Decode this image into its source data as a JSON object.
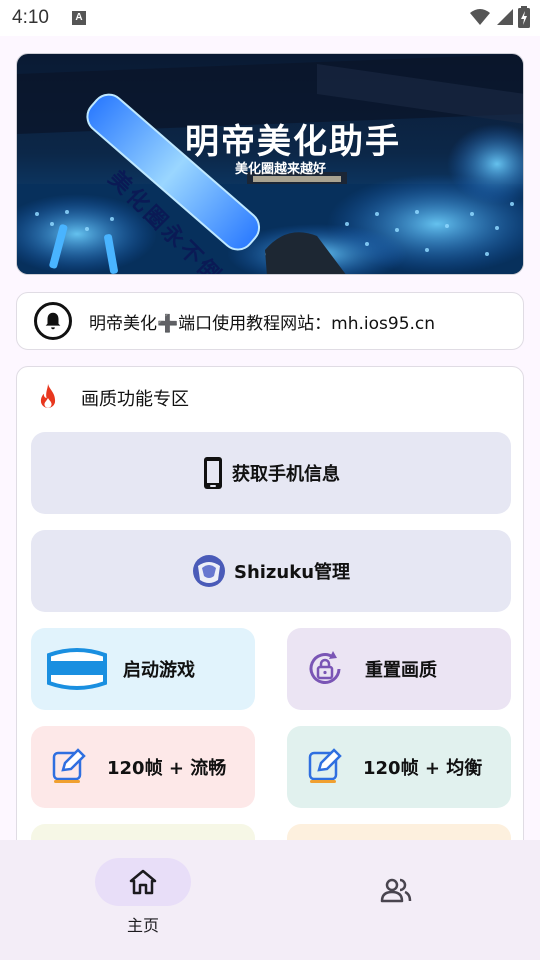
{
  "status_bar": {
    "time": "4:10",
    "notification_glyph": "A",
    "icons": [
      "wifi-icon",
      "signal-icon",
      "battery-icon"
    ]
  },
  "banner": {
    "title": "明帝美化助手",
    "subtitle": "美化圈越来越好",
    "glowstick_text": "美化圈永不倒"
  },
  "notice": {
    "icon": "bell-icon",
    "text": "明帝美化➕端口使用教程网站：mh.ios95.cn"
  },
  "panel": {
    "icon": "fire-icon",
    "title": "画质功能专区",
    "buttons": [
      {
        "label": "获取手机信息",
        "icon": "phone-icon"
      },
      {
        "label": "Shizuku管理",
        "icon": "shizuku-icon"
      }
    ],
    "tiles": [
      {
        "label": "启动游戏",
        "icon": "vr-goggles-icon",
        "color": "#e1f3fc"
      },
      {
        "label": "重置画质",
        "icon": "lock-reset-icon",
        "color": "#ebe4f3"
      },
      {
        "label": "120帧 + 流畅",
        "icon": "edit-icon",
        "color": "#fde8e8"
      },
      {
        "label": "120帧 + 均衡",
        "icon": "edit-icon",
        "color": "#e1f1ee"
      }
    ]
  },
  "bottom_nav": {
    "items": [
      {
        "label": "主页",
        "icon": "home-icon",
        "active": true
      },
      {
        "label": "",
        "icon": "users-icon",
        "active": false
      }
    ],
    "accent": "#e8def8"
  }
}
